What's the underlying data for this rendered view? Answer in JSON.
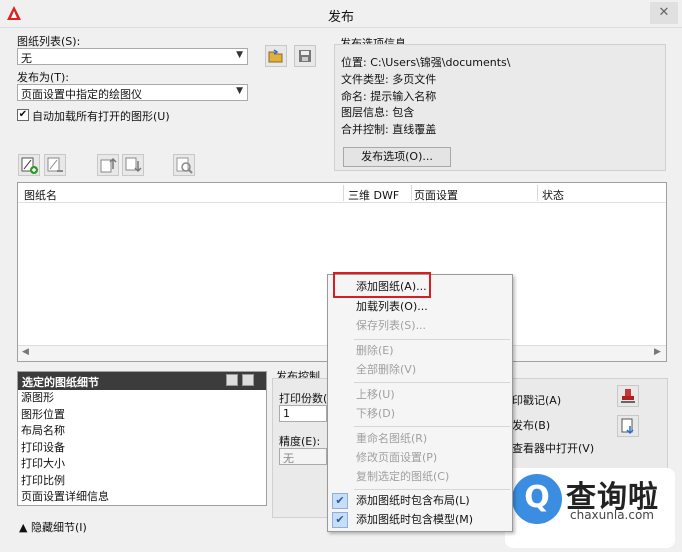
{
  "window": {
    "title": "发布",
    "close": "✕"
  },
  "sheet_list": {
    "label": "图纸列表(S):",
    "value": "无"
  },
  "publish_to": {
    "label": "发布为(T):",
    "value": "页面设置中指定的绘图仪"
  },
  "auto_load": {
    "label": "自动加载所有打开的图形(U)",
    "checked": true
  },
  "publish_info": {
    "title": "发布选项信息",
    "location": "位置: C:\\Users\\锦强\\documents\\",
    "file_type": "文件类型: 多页文件",
    "naming": "命名: 提示输入名称",
    "layer_info": "图层信息: 包含",
    "merge_control": "合并控制: 直线覆盖",
    "options_button": "发布选项(O)..."
  },
  "sheet_table": {
    "columns": [
      "图纸名",
      "三维 DWF",
      "页面设置",
      "状态"
    ]
  },
  "detail": {
    "header": "选定的图纸细节",
    "items": [
      "源图形",
      "图形位置",
      "布局名称",
      "打印设备",
      "打印大小",
      "打印比例",
      "页面设置详细信息"
    ]
  },
  "publish_control": {
    "title": "发布控制",
    "copies_label": "打印份数(",
    "copies_value": "1",
    "precision_label": "精度(E):",
    "precision_value": "无"
  },
  "right_options": {
    "stamp": "印戳记(A)",
    "publish_bg": "发布(B)",
    "open_viewer": "查看器中打开(V)"
  },
  "hide_details": "隐藏细节(I)",
  "context_menu": {
    "items": [
      {
        "label": "添加图纸(A)...",
        "disabled": false,
        "checked": false
      },
      {
        "label": "加载列表(O)...",
        "disabled": false,
        "checked": false
      },
      {
        "label": "保存列表(S)...",
        "disabled": true,
        "checked": false
      },
      {
        "label": "删除(E)",
        "disabled": true,
        "checked": false
      },
      {
        "label": "全部删除(V)",
        "disabled": true,
        "checked": false
      },
      {
        "label": "上移(U)",
        "disabled": true,
        "checked": false
      },
      {
        "label": "下移(D)",
        "disabled": true,
        "checked": false
      },
      {
        "label": "重命名图纸(R)",
        "disabled": true,
        "checked": false
      },
      {
        "label": "修改页面设置(P)",
        "disabled": true,
        "checked": false
      },
      {
        "label": "复制选定的图纸(C)",
        "disabled": true,
        "checked": false
      },
      {
        "label": "添加图纸时包含布局(L)",
        "disabled": false,
        "checked": true
      },
      {
        "label": "添加图纸时包含模型(M)",
        "disabled": false,
        "checked": true
      }
    ]
  },
  "watermark": {
    "text": "查询啦",
    "url": "chaxunla.com",
    "symbol": "Q"
  }
}
